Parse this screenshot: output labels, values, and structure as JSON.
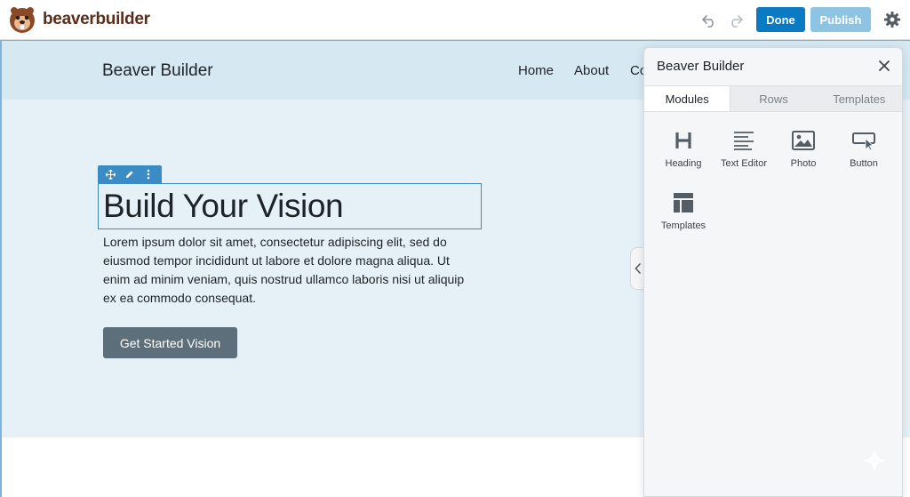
{
  "brand": {
    "name": "beaverbuilder"
  },
  "topbar": {
    "done_label": "Done",
    "publish_label": "Publish"
  },
  "site": {
    "title": "Beaver Builder",
    "nav": [
      "Home",
      "About",
      "Co"
    ]
  },
  "hero": {
    "heading": "Build Your Vision",
    "paragraph": "Lorem ipsum dolor sit amet, consectetur adipiscing elit, sed do eiusmod tempor incididunt ut labore et dolore magna aliqua. Ut enim ad minim veniam, quis nostrud ullamco laboris nisi ut aliquip ex ea commodo consequat.",
    "cta_label": "Get Started Vision"
  },
  "panel": {
    "title": "Beaver Builder",
    "tabs": [
      {
        "label": "Modules",
        "active": true
      },
      {
        "label": "Rows",
        "active": false
      },
      {
        "label": "Templates",
        "active": false
      }
    ],
    "modules": [
      {
        "label": "Heading",
        "icon": "heading-icon"
      },
      {
        "label": "Text Editor",
        "icon": "text-editor-icon"
      },
      {
        "label": "Photo",
        "icon": "photo-icon"
      },
      {
        "label": "Button",
        "icon": "button-icon"
      },
      {
        "label": "Templates",
        "icon": "templates-icon"
      }
    ]
  },
  "colors": {
    "accent": "#0a7ac2",
    "publish": "#8ec4e3",
    "selection": "#3b8cc5",
    "hero_bg": "#e6f1f7",
    "header_bg": "#d6e8f1",
    "cta": "#5d6f7a"
  }
}
